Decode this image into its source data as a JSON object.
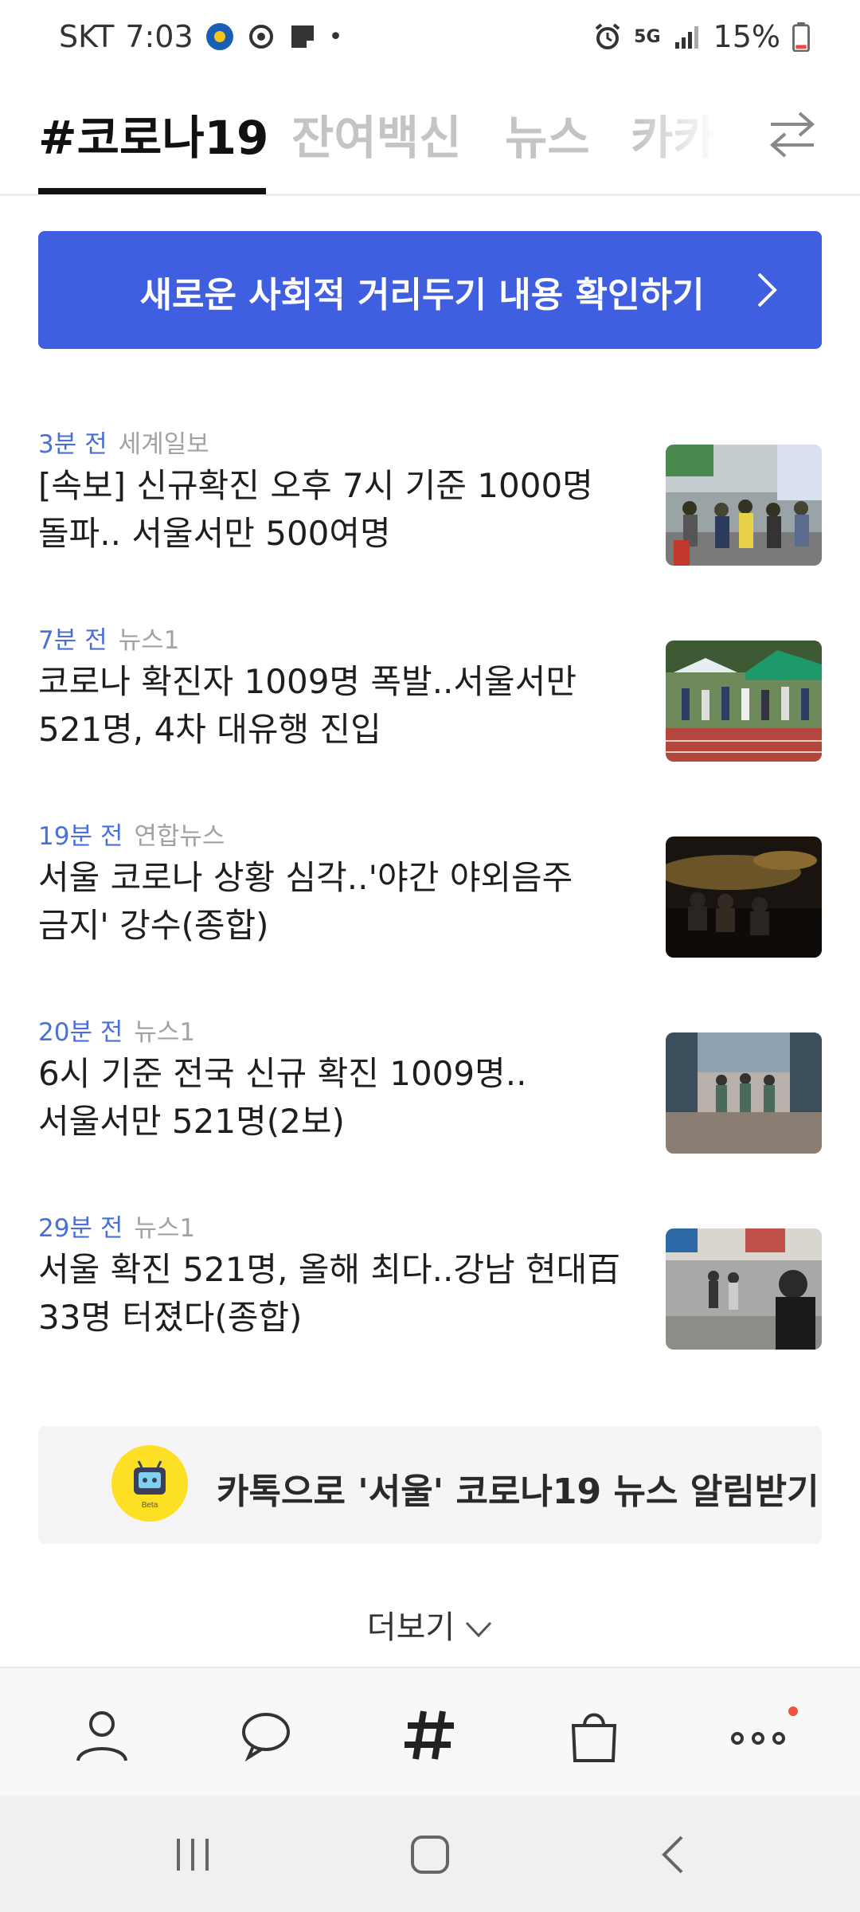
{
  "status_bar": {
    "carrier": "SKT",
    "time": "7:03",
    "dot": "•",
    "network": "5G",
    "battery": "15%"
  },
  "tabs": [
    {
      "label": "#코로나19",
      "active": true
    },
    {
      "label": "잔여백신",
      "active": false
    },
    {
      "label": "뉴스",
      "active": false
    },
    {
      "label": "카카",
      "active": false
    }
  ],
  "banner": {
    "text": "새로운 사회적 거리두기 내용 확인하기"
  },
  "news": [
    {
      "time": "3분 전",
      "source": "세계일보",
      "title": "[속보] 신규확진 오후 7시 기준 1000명 돌파.. 서울서만 500여명"
    },
    {
      "time": "7분 전",
      "source": "뉴스1",
      "title": "코로나 확진자 1009명 폭발..서울서만 521명, 4차 대유행 진입"
    },
    {
      "time": "19분 전",
      "source": "연합뉴스",
      "title": "서울 코로나 상황 심각..'야간 야외음주 금지' 강수(종합)"
    },
    {
      "time": "20분 전",
      "source": "뉴스1",
      "title": "6시 기준 전국 신규 확진 1009명..서울서만 521명(2보)"
    },
    {
      "time": "29분 전",
      "source": "뉴스1",
      "title": "서울 확진 521명, 올해 최다..강남 현대百 33명 터졌다(종합)"
    }
  ],
  "notify": {
    "text": "카톡으로 '서울' 코로나19 뉴스 알림받기",
    "badge": "Beta"
  },
  "more": {
    "label": "더보기"
  },
  "colors": {
    "accent": "#3f5fe0",
    "time": "#4a6fd6",
    "kakao": "#fde024",
    "badge_dot": "#f0533b"
  }
}
